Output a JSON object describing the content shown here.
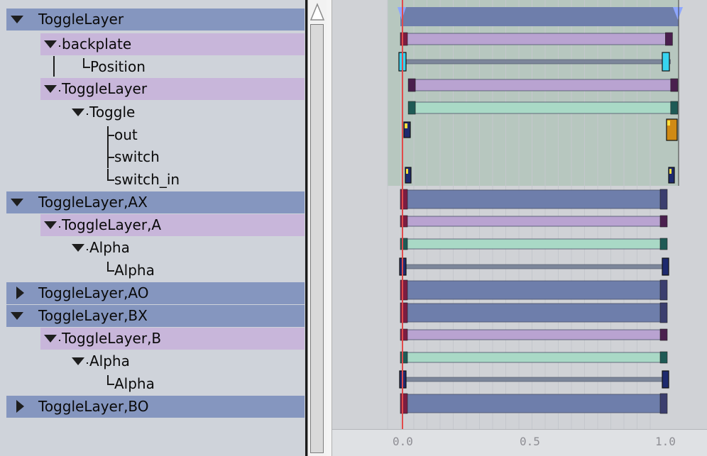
{
  "tree": {
    "rows": [
      {
        "label": "ToggleLayer"
      },
      {
        "label": "backplate"
      },
      {
        "label": "Position"
      },
      {
        "label": "ToggleLayer"
      },
      {
        "label": "Toggle"
      },
      {
        "label": "out"
      },
      {
        "label": "switch"
      },
      {
        "label": "switch_in"
      },
      {
        "label": "ToggleLayer,AX"
      },
      {
        "label": "ToggleLayer,A"
      },
      {
        "label": "Alpha"
      },
      {
        "label": "Alpha"
      },
      {
        "label": "ToggleLayer,AO"
      },
      {
        "label": "ToggleLayer,BX"
      },
      {
        "label": "ToggleLayer,B"
      },
      {
        "label": "Alpha"
      },
      {
        "label": "Alpha"
      },
      {
        "label": "ToggleLayer,BO"
      }
    ]
  },
  "timeline": {
    "ruler": {
      "labels": [
        "0.0",
        "0.5",
        "1.0"
      ]
    },
    "playhead_time": 0.0,
    "colors": {
      "layer": "#6e7eab",
      "purple": "#b9a3d1",
      "green": "#a9d9c6",
      "gray": "#7c869a",
      "selected_region": "#b7c7bf",
      "playhead": "#e24a4a"
    }
  }
}
